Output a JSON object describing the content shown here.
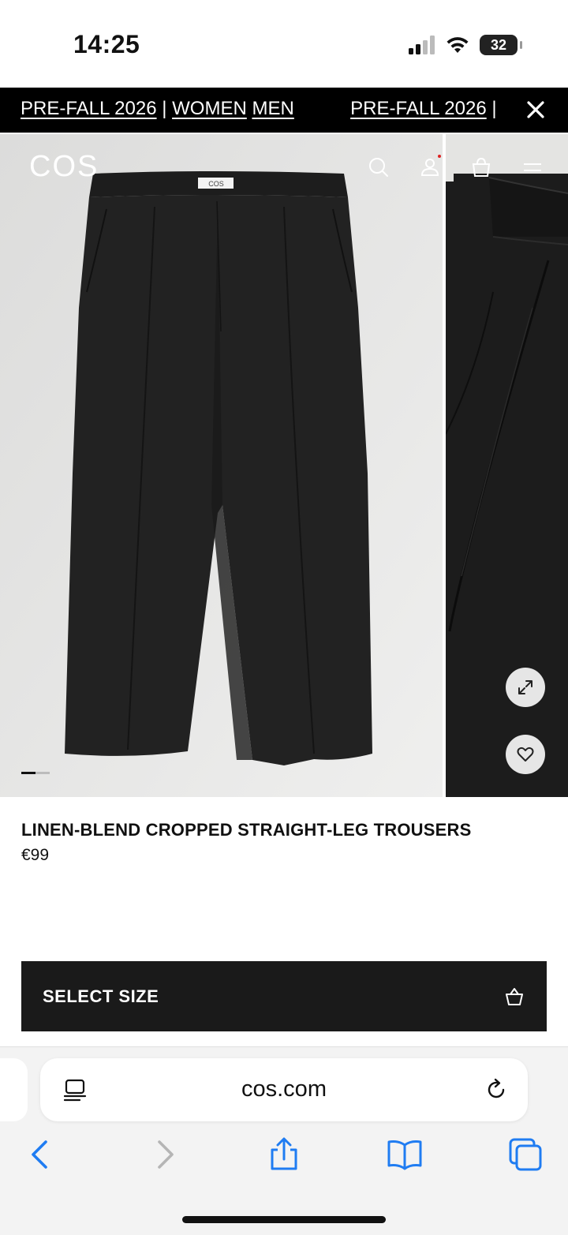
{
  "status": {
    "time": "14:25",
    "battery": "32"
  },
  "promo": {
    "items": [
      "PRE-FALL 2026",
      "WOMEN",
      "MEN"
    ],
    "separator": "|",
    "repeat_head": "PRE-FALL 2026",
    "repeat_sep": "|"
  },
  "header": {
    "logo": "COS"
  },
  "product": {
    "title": "LINEN-BLEND CROPPED STRAIGHT-LEG TROUSERS",
    "price": "€99",
    "label_tag": "COS"
  },
  "gallery": {
    "slide_count": 2,
    "active_slide": 1
  },
  "cta": {
    "select_size": "SELECT SIZE"
  },
  "browser": {
    "url": "cos.com"
  },
  "colors": {
    "banner": "#000000",
    "cta": "#1a1a1a",
    "accent_dot": "#dd2222",
    "ios_blue": "#1f7cf2"
  }
}
